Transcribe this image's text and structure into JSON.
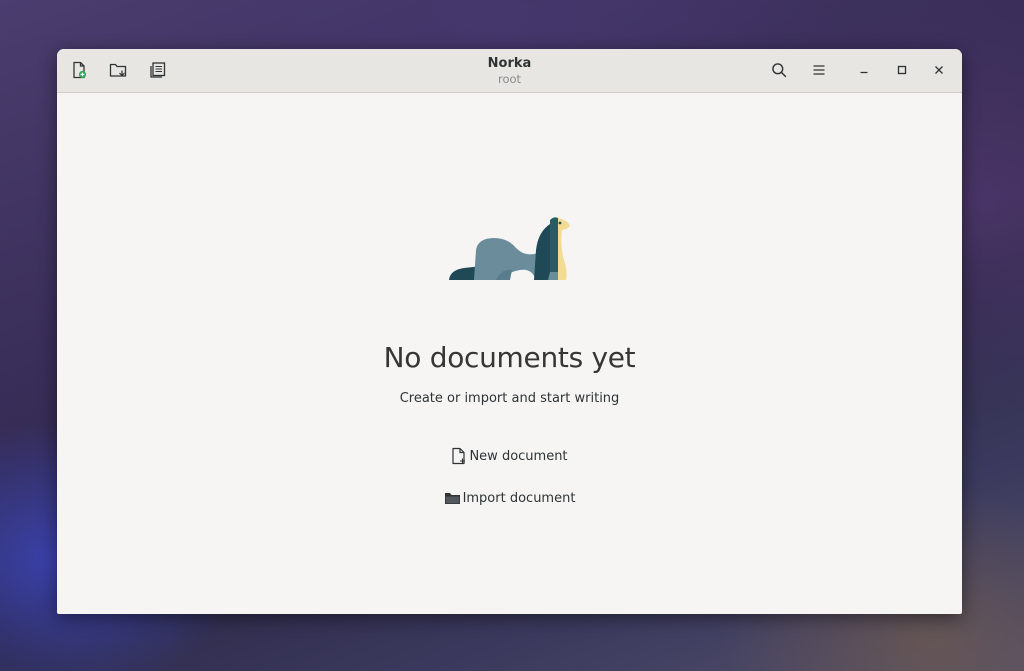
{
  "window": {
    "title": "Norka",
    "subtitle": "root"
  },
  "headerbar": {
    "left_icons": [
      "new-document-icon",
      "import-folder-icon",
      "documents-list-icon"
    ],
    "right_icons": [
      "search-icon",
      "menu-icon",
      "minimize-icon",
      "maximize-icon",
      "close-icon"
    ]
  },
  "empty_state": {
    "title": "No documents yet",
    "description": "Create or import and start writing",
    "new_document_label": "New document",
    "import_document_label": "Import document"
  },
  "colors": {
    "window_bg": "#f6f5f4",
    "headerbar_bg": "#e8e6e3",
    "text": "#2e3436",
    "mascot_body": "#6b8d9b",
    "mascot_dark": "#1f4a55",
    "mascot_belly": "#f2dc94"
  }
}
